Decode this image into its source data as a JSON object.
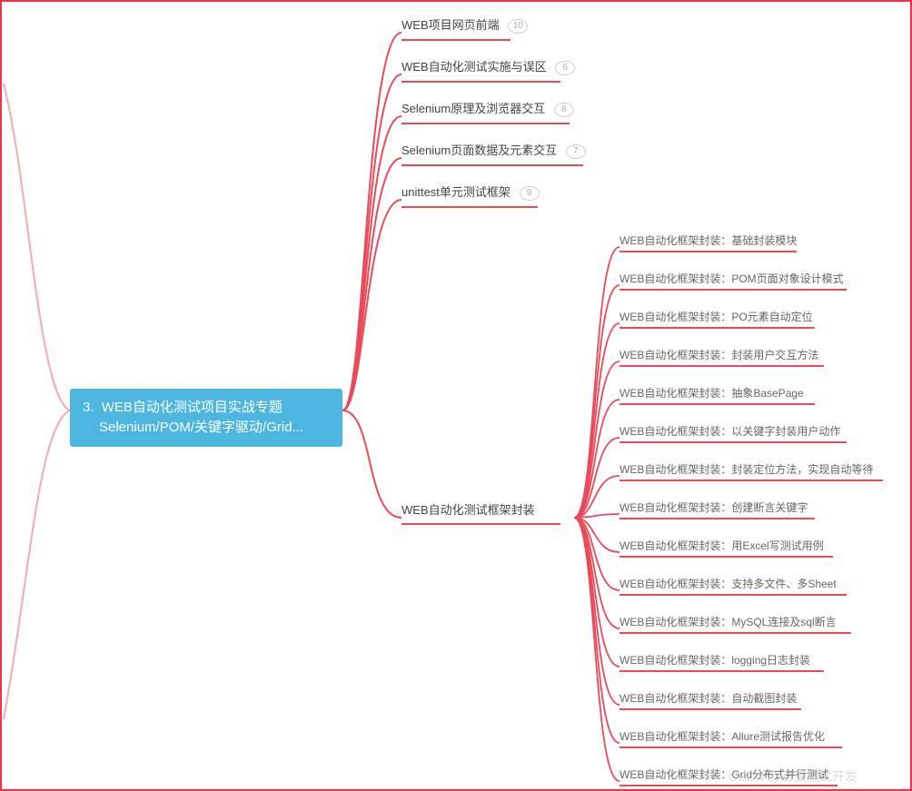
{
  "colors": {
    "accent": "#e94b5b",
    "root_bg": "#4db6e0",
    "root_fg": "#ffffff",
    "border": "#f3334d"
  },
  "root": {
    "number": "3.",
    "line1": "WEB自动化测试项目实战专题",
    "line2": "Selenium/POM/关键字驱动/Grid..."
  },
  "level1": [
    {
      "label": "WEB项目网页前端",
      "badge": "10"
    },
    {
      "label": "WEB自动化测试实施与误区",
      "badge": "6"
    },
    {
      "label": "Selenium原理及浏览器交互",
      "badge": "8"
    },
    {
      "label": "Selenium页面数据及元素交互",
      "badge": "7"
    },
    {
      "label": "unittest单元测试框架",
      "badge": "9"
    },
    {
      "label": "WEB自动化测试框架封装",
      "badge": null
    }
  ],
  "level2_parent_index": 5,
  "level2": [
    "WEB自动化框架封装：基础封装模块",
    "WEB自动化框架封装：POM页面对象设计模式",
    "WEB自动化框架封装：PO元素自动定位",
    "WEB自动化框架封装：封装用户交互方法",
    "WEB自动化框架封装：抽象BasePage",
    "WEB自动化框架封装：以关键字封装用户动作",
    "WEB自动化框架封装：封装定位方法，实现自动等待",
    "WEB自动化框架封装：创建断言关键字",
    "WEB自动化框架封装：用Excel写测试用例",
    "WEB自动化框架封装：支持多文件、多Sheet",
    "WEB自动化框架封装：MySQL连接及sql断言",
    "WEB自动化框架封装：logging日志封装",
    "WEB自动化框架封装：自动截图封装",
    "WEB自动化框架封装：Allure测试报告优化",
    "WEB自动化框架封装：Grid分布式并行测试"
  ],
  "watermark": "CSDN @百度测试开发"
}
